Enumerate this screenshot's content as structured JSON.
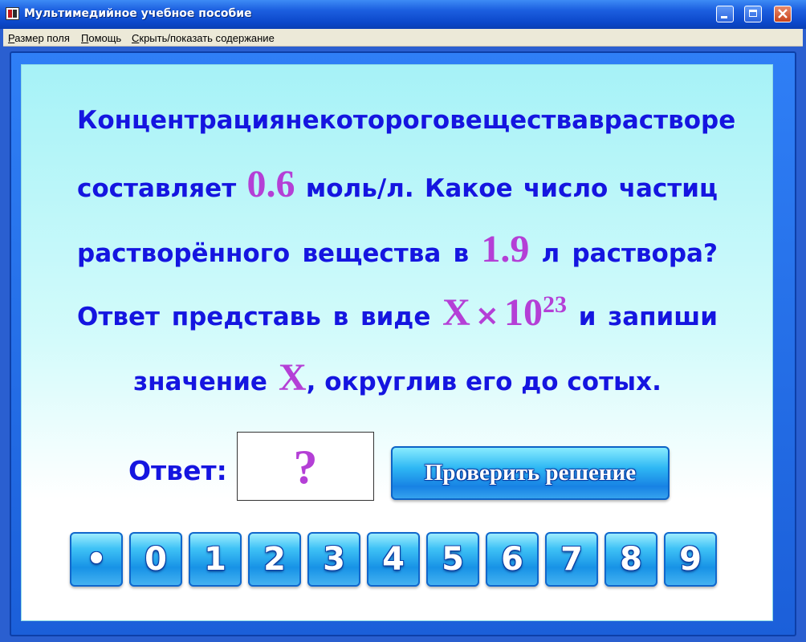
{
  "window": {
    "title": "Мультимедийное учебное пособие"
  },
  "menu": {
    "items": [
      {
        "prefix": "Р",
        "rest": "азмер поля"
      },
      {
        "prefix": "П",
        "rest": "омощь"
      },
      {
        "prefix": "С",
        "rest": "крыть/показать содержание"
      }
    ]
  },
  "question": {
    "line1": [
      "Концентрация",
      "некоторого",
      "вещества",
      "в",
      "растворе"
    ],
    "line2_word1": "составляет",
    "concentration": "0.6",
    "line2_rest": [
      "моль/л.",
      "Какое",
      "число",
      "частиц"
    ],
    "line3_word1": "растворённого",
    "line3_word2": "вещества",
    "line3_word3": "в",
    "volume": "1.9",
    "line3_rest": [
      "л",
      "раствора?"
    ],
    "line4_start": [
      "Ответ",
      "представь",
      "в",
      "виде"
    ],
    "formula_var": "X",
    "formula_times": "×",
    "formula_base": "10",
    "formula_exp": "23",
    "line4_end": [
      "и",
      "запиши"
    ],
    "line5_start": "значение",
    "line5_var": "X",
    "line5_end": ", округлив его до сотых."
  },
  "answer": {
    "label": "Ответ:",
    "value": "?"
  },
  "check_button": {
    "label": "Проверить решение"
  },
  "keypad": {
    "keys": [
      "•",
      "0",
      "1",
      "2",
      "3",
      "4",
      "5",
      "6",
      "7",
      "8",
      "9"
    ]
  },
  "colors": {
    "text_blue": "#1515e0",
    "accent_purple": "#b43fd6",
    "panel_blue": "#2f7ff6",
    "panel_cyan": "#a6f2f7"
  }
}
